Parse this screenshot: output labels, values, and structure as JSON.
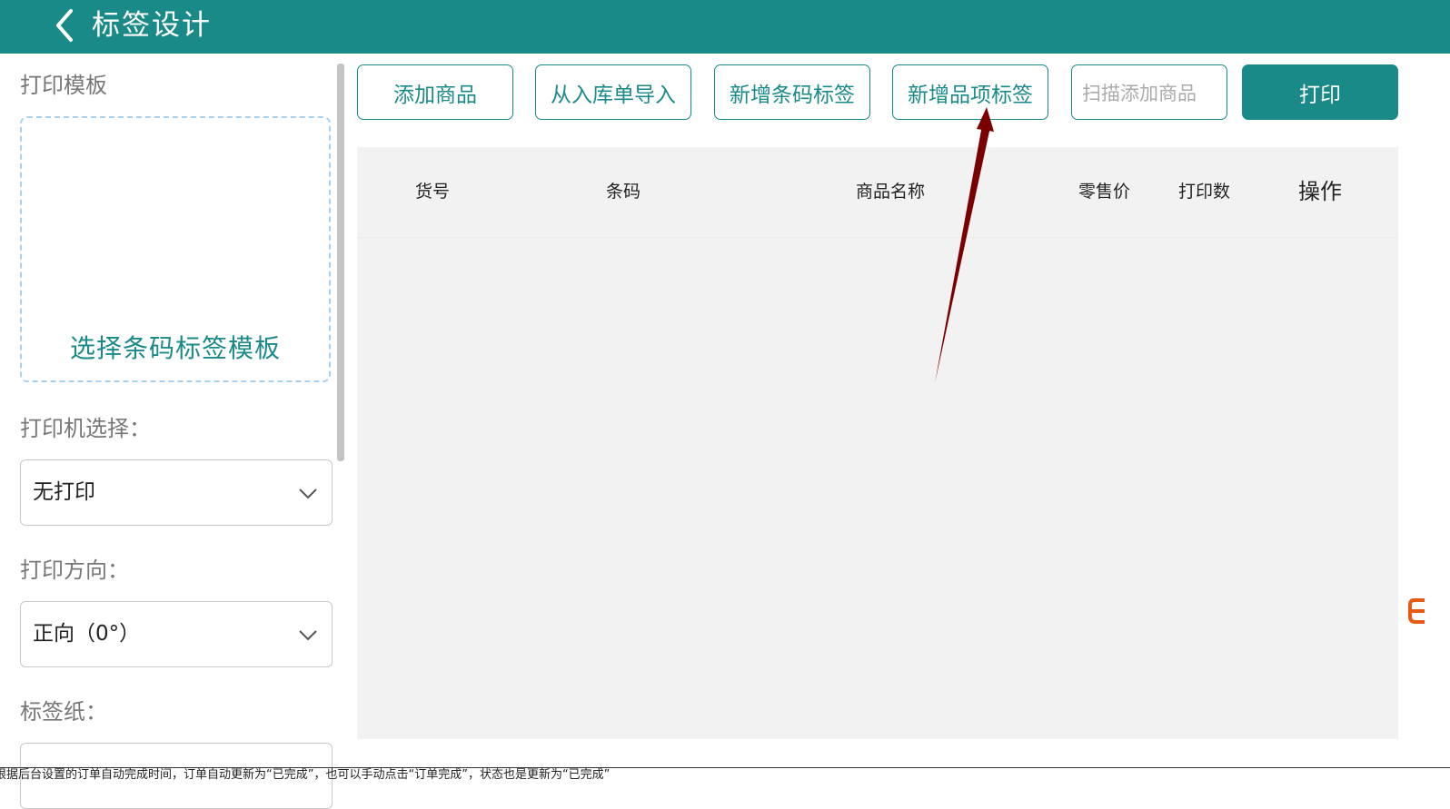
{
  "header": {
    "title": "标签设计"
  },
  "sidebar": {
    "template_label": "打印模板",
    "template_placeholder": "选择条码标签模板",
    "printer_label": "打印机选择：",
    "printer_value": "无打印",
    "direction_label": "打印方向：",
    "direction_value": "正向（0°）",
    "paper_label": "标签纸："
  },
  "toolbar": {
    "add_product": "添加商品",
    "import_from_receipt": "从入库单导入",
    "add_barcode_label": "新增条码标签",
    "add_item_label": "新增品项标签",
    "scan_placeholder": "扫描添加商品",
    "print": "打印"
  },
  "table": {
    "columns": [
      "货号",
      "条码",
      "商品名称",
      "零售价",
      "打印数",
      "操作"
    ],
    "rows": []
  },
  "footer_text": "根据后台设置的订单自动完成时间，订单自动更新为“已完成”，也可以手动点击“订单完成”，状态也是更新为“已完成”",
  "colors": {
    "accent": "#1a8a89",
    "annotation_arrow": "#7a0000",
    "table_bg": "#f2f2f2"
  }
}
